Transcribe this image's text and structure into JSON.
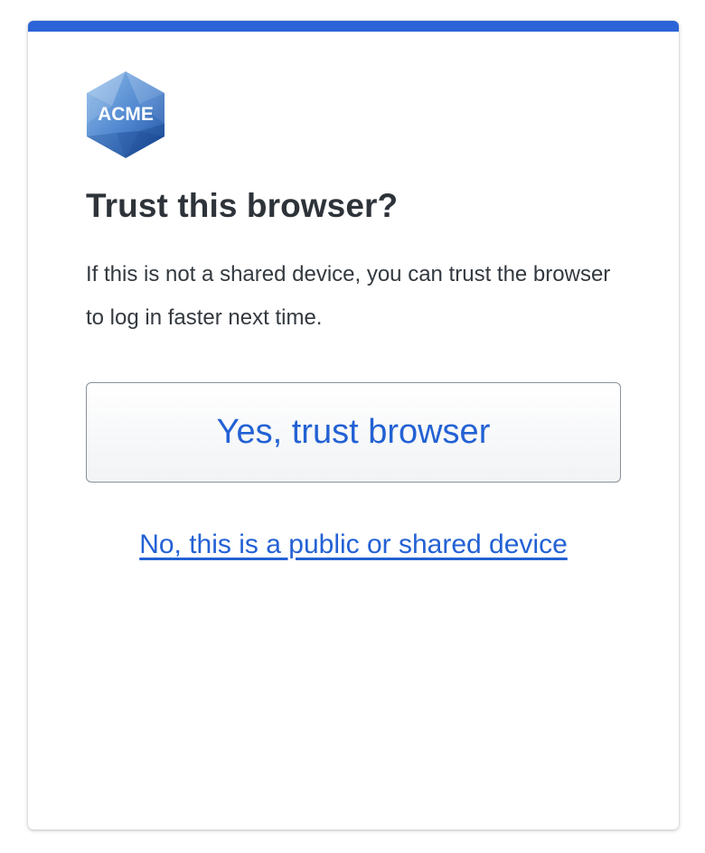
{
  "logo": {
    "text": "ACME",
    "color": "#4a86d4"
  },
  "dialog": {
    "title": "Trust this browser?",
    "description": "If this is not a shared device, you can trust the browser to log in faster next time.",
    "accent_color": "#2c63d6"
  },
  "actions": {
    "trust_label": "Yes, trust browser",
    "decline_label": "No, this is a public or shared device",
    "link_color": "#2361d4"
  }
}
